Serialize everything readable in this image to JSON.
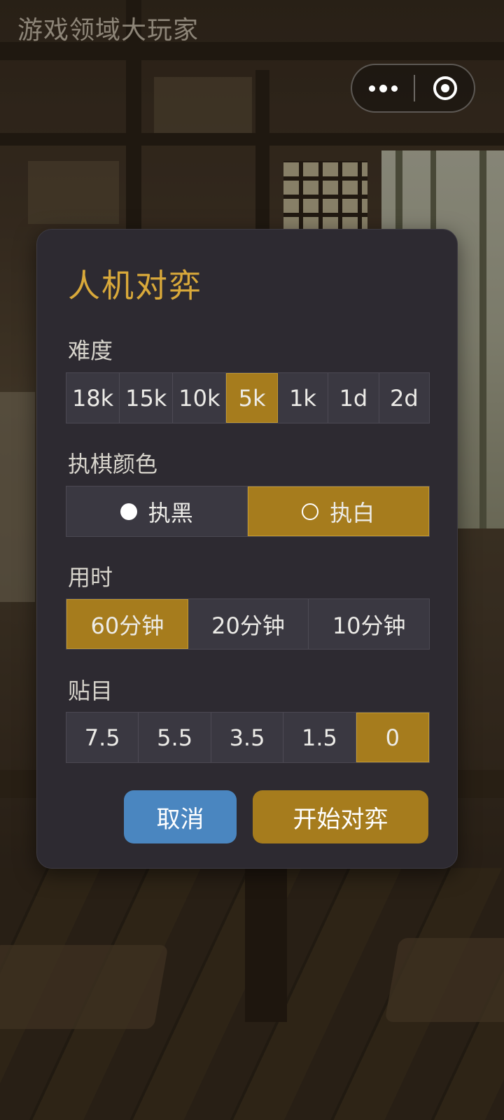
{
  "app": {
    "title": "游戏领域大玩家"
  },
  "capsule": {
    "more_icon": "more-dots-icon",
    "close_icon": "target-circle-icon"
  },
  "dialog": {
    "title": "人机对弈",
    "difficulty": {
      "label": "难度",
      "options": [
        "18k",
        "15k",
        "10k",
        "5k",
        "1k",
        "1d",
        "2d"
      ],
      "selected": "5k"
    },
    "color": {
      "label": "执棋颜色",
      "options": [
        {
          "label": "执黑",
          "icon": "filled-circle-icon"
        },
        {
          "label": "执白",
          "icon": "hollow-circle-icon"
        }
      ],
      "selected": "执白"
    },
    "time": {
      "label": "用时",
      "options": [
        "60分钟",
        "20分钟",
        "10分钟"
      ],
      "selected": "60分钟"
    },
    "komi": {
      "label": "贴目",
      "options": [
        "7.5",
        "5.5",
        "3.5",
        "1.5",
        "0"
      ],
      "selected": "0"
    },
    "buttons": {
      "cancel": "取消",
      "start": "开始对弈"
    }
  },
  "colors": {
    "accent_gold": "#a67c1d",
    "title_gold": "#d9a93a",
    "cancel_blue": "#4a86c0",
    "dialog_bg": "#2d2a31"
  }
}
